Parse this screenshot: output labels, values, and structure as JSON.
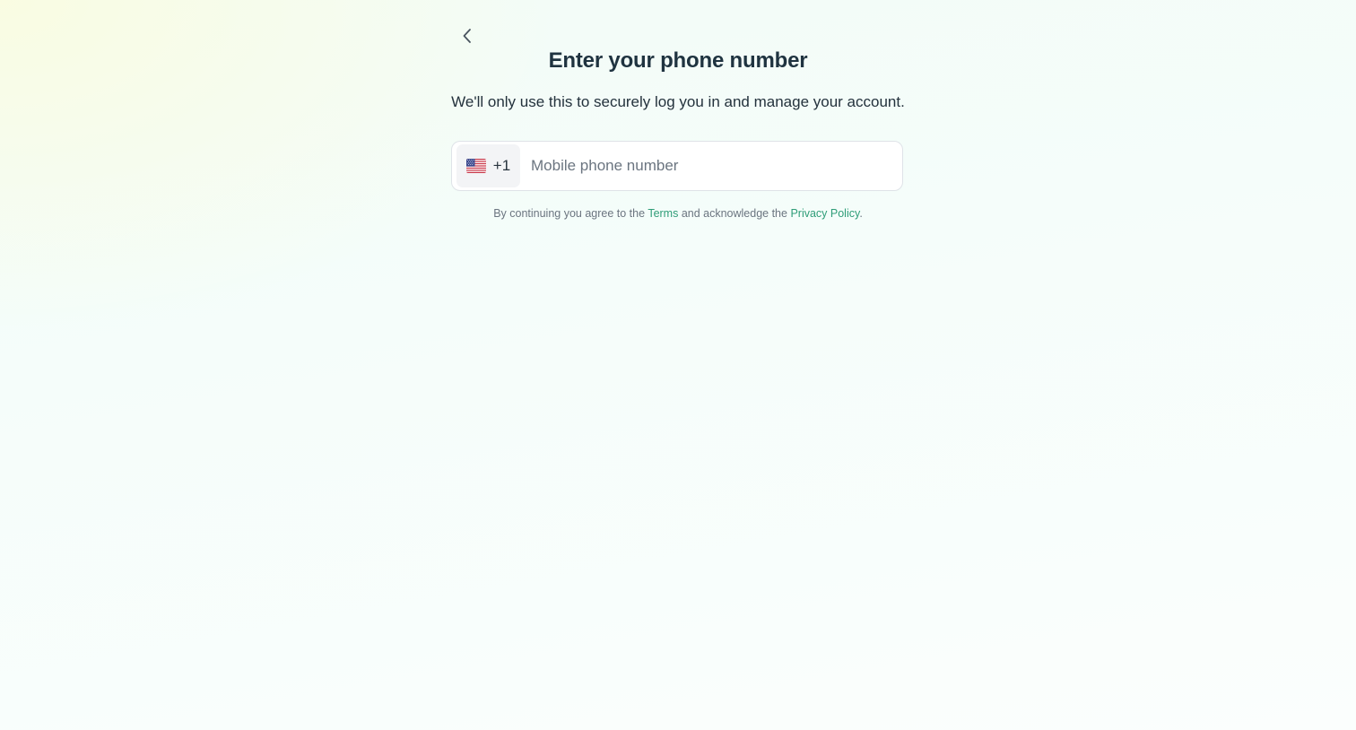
{
  "header": {
    "back_icon": "chevron-left-icon",
    "title": "Enter your phone number",
    "subtitle": "We'll only use this to securely log you in and manage your account."
  },
  "phone_field": {
    "country_flag_icon": "us-flag-icon",
    "dial_code": "+1",
    "value": "",
    "placeholder": "Mobile phone number"
  },
  "legal": {
    "prefix": "By continuing you agree to the ",
    "terms_link": "Terms",
    "middle": " and acknowledge the ",
    "privacy_link": "Privacy Policy",
    "suffix": "."
  },
  "colors": {
    "accent": "#2f9d78",
    "heading": "#1f3340",
    "muted_text": "#6b7580",
    "field_border": "#dfe3e8"
  }
}
